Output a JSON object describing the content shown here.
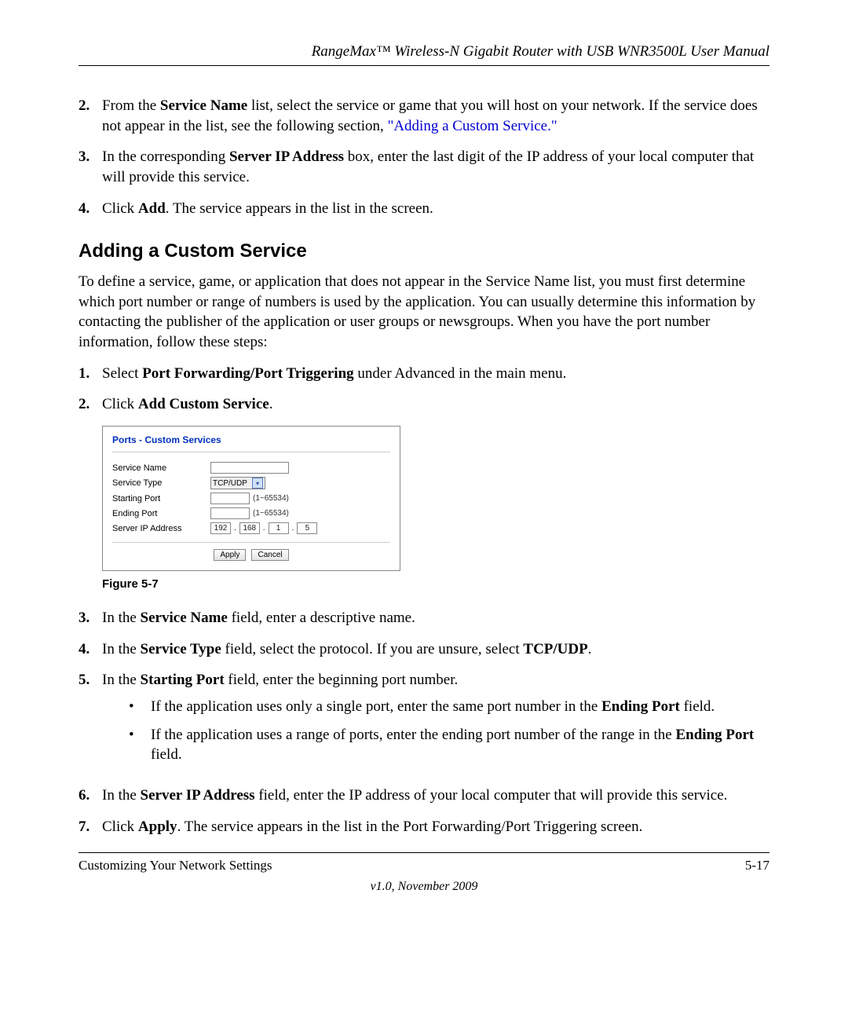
{
  "header": {
    "title": "RangeMax™ Wireless-N Gigabit Router with USB WNR3500L User Manual"
  },
  "top_steps": {
    "s2": {
      "num": "2.",
      "pre": "From the ",
      "bold1": "Service Name",
      "mid": " list, select the service or game that you will host on your network. If the service does not appear in the list, see the following section, ",
      "link": "\"Adding a Custom Service.\"",
      "post": ""
    },
    "s3": {
      "num": "3.",
      "pre": "In the corresponding ",
      "bold1": "Server IP Address",
      "post": " box, enter the last digit of the IP address of your local computer that will provide this service."
    },
    "s4": {
      "num": "4.",
      "pre": "Click ",
      "bold1": "Add",
      "post": ". The service appears in the list in the screen."
    }
  },
  "section_heading": "Adding a Custom Service",
  "section_para": "To define a service, game, or application that does not appear in the Service Name list, you must first determine which port number or range of numbers is used by the application. You can usually determine this information by contacting the publisher of the application or user groups or newsgroups. When you have the port number information, follow these steps:",
  "custom_steps": {
    "s1": {
      "num": "1.",
      "pre": "Select ",
      "bold1": "Port Forwarding/Port Triggering",
      "post": " under Advanced in the main menu."
    },
    "s2": {
      "num": "2.",
      "pre": "Click ",
      "bold1": "Add Custom Service",
      "post": "."
    },
    "s3": {
      "num": "3.",
      "pre": "In the ",
      "bold1": "Service Name",
      "post": " field, enter a descriptive name."
    },
    "s4": {
      "num": "4.",
      "pre": "In the ",
      "bold1": "Service Type",
      "mid": " field, select the protocol. If you are unsure, select ",
      "bold2": "TCP/UDP",
      "post": "."
    },
    "s5": {
      "num": "5.",
      "pre": "In the ",
      "bold1": "Starting Port",
      "post": " field, enter the beginning port number."
    },
    "s5a": {
      "pre": "If the application uses only a single port, enter the same port number in the ",
      "bold1": "Ending Port",
      "post": " field."
    },
    "s5b": {
      "pre": "If the application uses a range of ports, enter the ending port number of the range in the ",
      "bold1": "Ending Port",
      "post": " field."
    },
    "s6": {
      "num": "6.",
      "pre": "In the ",
      "bold1": "Server IP Address",
      "post": " field, enter the IP address of your local computer that will provide this service."
    },
    "s7": {
      "num": "7.",
      "pre": "Click ",
      "bold1": "Apply",
      "post": ". The service appears in the list in the Port Forwarding/Port Triggering screen."
    }
  },
  "shot": {
    "title": "Ports - Custom Services",
    "labels": {
      "service_name": "Service Name",
      "service_type": "Service Type",
      "starting_port": "Starting Port",
      "ending_port": "Ending Port",
      "server_ip": "Server IP Address"
    },
    "select_value": "TCP/UDP",
    "range_note": "(1~65534)",
    "ip": {
      "a": "192",
      "b": "168",
      "c": "1",
      "d": "5"
    },
    "btn_apply": "Apply",
    "btn_cancel": "Cancel"
  },
  "figure_caption": "Figure 5-7",
  "footer": {
    "left": "Customizing Your Network Settings",
    "right": "5-17",
    "version": "v1.0, November 2009"
  }
}
